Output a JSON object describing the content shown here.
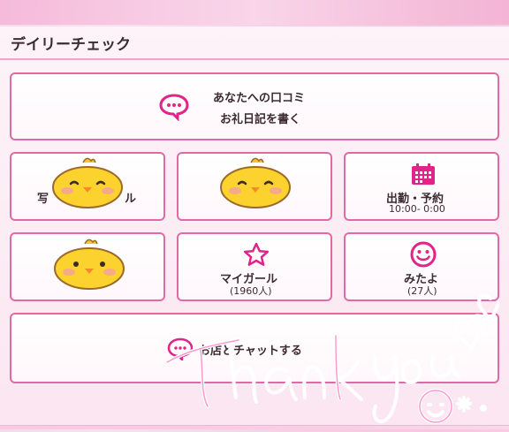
{
  "header": {
    "title": "デイリーチェック"
  },
  "review": {
    "line1": "あなたへの口コミ",
    "line2": "お礼日記を書く"
  },
  "tiles": {
    "photo": {
      "label_left": "写",
      "label_right": "ル"
    },
    "shift": {
      "label": "出勤・予約",
      "time": "10:00- 0:00"
    },
    "mygirl": {
      "label": "マイガール",
      "count": "(1960人)"
    },
    "mitayo": {
      "label": "みたよ",
      "count": "(27人)"
    }
  },
  "chat": {
    "label": "お店とチャットする"
  },
  "overlay": {
    "thankyou": "Thank you"
  },
  "colors": {
    "accent": "#e0248a",
    "border": "#e06aa5",
    "text": "#3b2b30"
  },
  "icons": {
    "review": "chat-bubble-icon",
    "calendar": "calendar-icon",
    "star": "star-icon",
    "smile": "smile-icon",
    "chat": "chat-icon"
  }
}
